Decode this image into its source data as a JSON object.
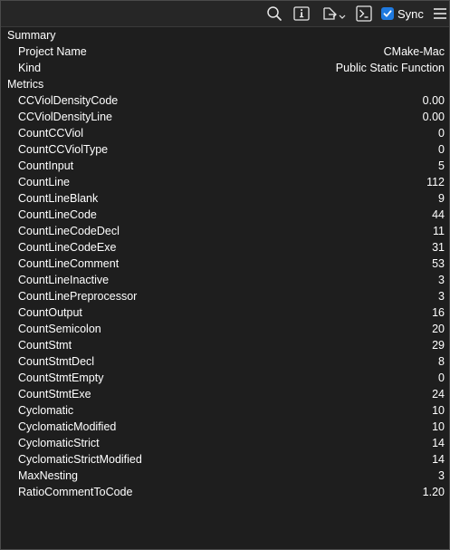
{
  "toolbar": {
    "icons": [
      "search-icon",
      "info-icon",
      "export-icon",
      "terminal-icon",
      "hamburger-menu-icon"
    ],
    "sync_label": "Sync",
    "sync_checked": true,
    "accent_color": "#1f7ae0"
  },
  "summary": {
    "heading": "Summary",
    "rows": [
      {
        "label": "Project Name",
        "value": "CMake-Mac"
      },
      {
        "label": "Kind",
        "value": "Public Static Function"
      }
    ]
  },
  "metrics": {
    "heading": "Metrics",
    "rows": [
      {
        "label": "CCViolDensityCode",
        "value": "0.00"
      },
      {
        "label": "CCViolDensityLine",
        "value": "0.00"
      },
      {
        "label": "CountCCViol",
        "value": "0"
      },
      {
        "label": "CountCCViolType",
        "value": "0"
      },
      {
        "label": "CountInput",
        "value": "5"
      },
      {
        "label": "CountLine",
        "value": "112"
      },
      {
        "label": "CountLineBlank",
        "value": "9"
      },
      {
        "label": "CountLineCode",
        "value": "44"
      },
      {
        "label": "CountLineCodeDecl",
        "value": "11"
      },
      {
        "label": "CountLineCodeExe",
        "value": "31"
      },
      {
        "label": "CountLineComment",
        "value": "53"
      },
      {
        "label": "CountLineInactive",
        "value": "3"
      },
      {
        "label": "CountLinePreprocessor",
        "value": "3"
      },
      {
        "label": "CountOutput",
        "value": "16"
      },
      {
        "label": "CountSemicolon",
        "value": "20"
      },
      {
        "label": "CountStmt",
        "value": "29"
      },
      {
        "label": "CountStmtDecl",
        "value": "8"
      },
      {
        "label": "CountStmtEmpty",
        "value": "0"
      },
      {
        "label": "CountStmtExe",
        "value": "24"
      },
      {
        "label": "Cyclomatic",
        "value": "10"
      },
      {
        "label": "CyclomaticModified",
        "value": "10"
      },
      {
        "label": "CyclomaticStrict",
        "value": "14"
      },
      {
        "label": "CyclomaticStrictModified",
        "value": "14"
      },
      {
        "label": "MaxNesting",
        "value": "3"
      },
      {
        "label": "RatioCommentToCode",
        "value": "1.20"
      }
    ]
  }
}
